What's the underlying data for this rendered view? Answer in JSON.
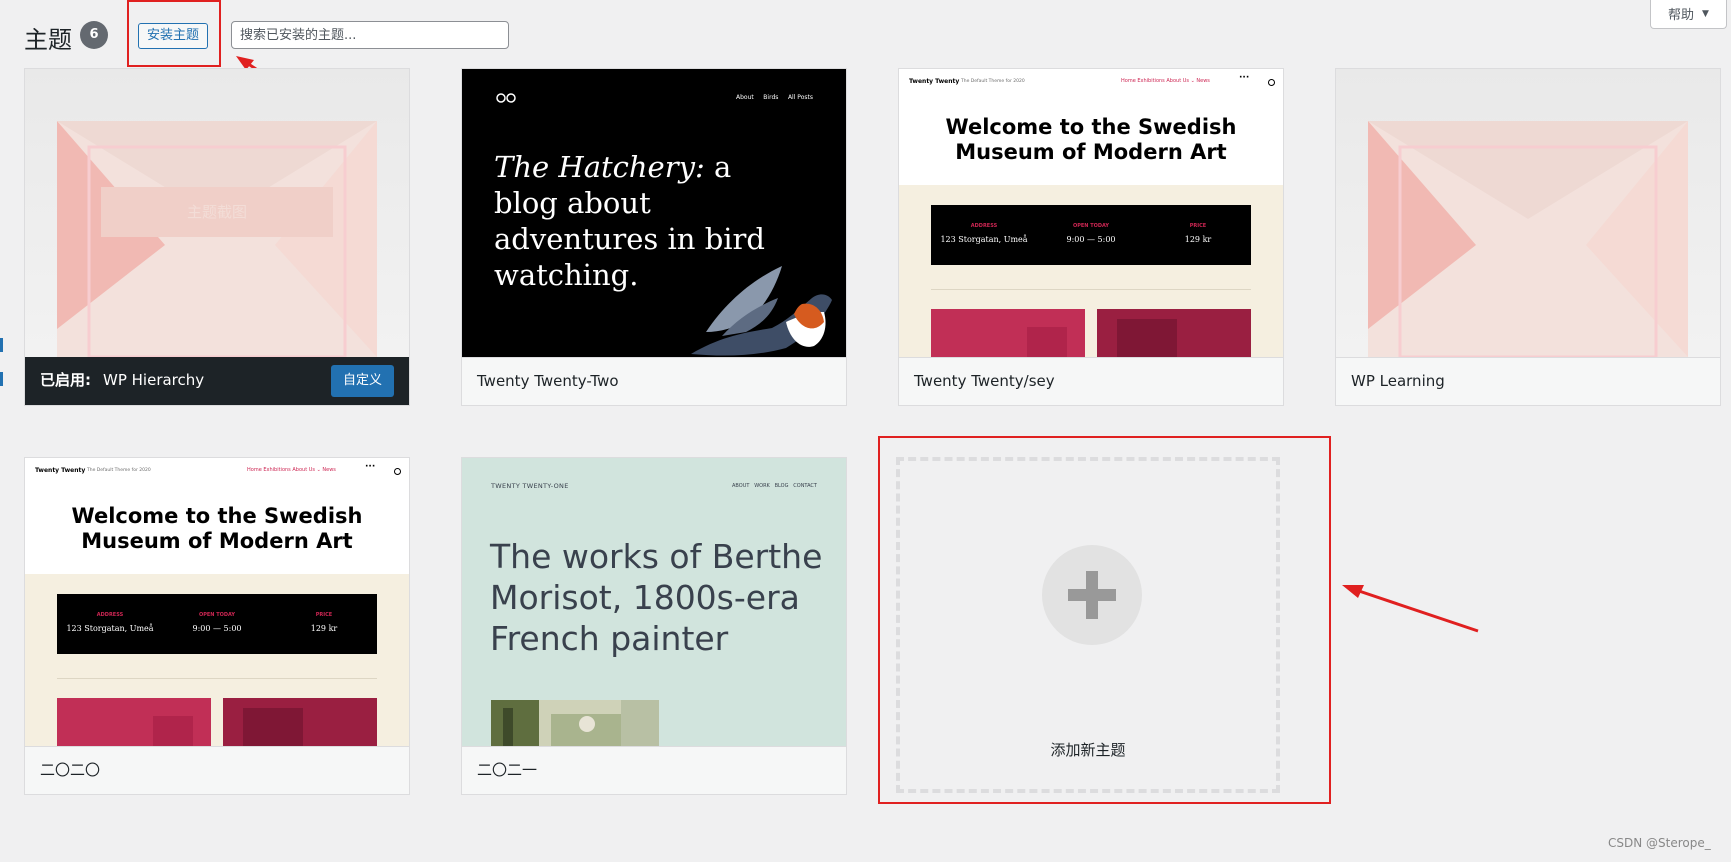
{
  "header": {
    "title": "主题",
    "count": "6",
    "install_label": "安装主题",
    "search_placeholder": "搜索已安装的主题...",
    "help_label": "帮助"
  },
  "themes": [
    {
      "name": "WP Hierarchy",
      "active": true,
      "active_label": "已启用:",
      "customize_label": "自定义",
      "placeholder_text": "主题截图"
    },
    {
      "name": "Twenty Twenty-Two",
      "preview": {
        "nav": [
          "About",
          "Birds",
          "All Posts"
        ],
        "headline_italic": "The Hatchery:",
        "headline_rest": " a blog about adventures in bird watching."
      }
    },
    {
      "name": "Twenty Twenty/sey",
      "preview": {
        "brand": "Twenty Twenty",
        "tagline": "The Default Theme for 2020",
        "nav": "Home   Exhibitions   About Us ⌄   News",
        "headline": "Welcome to the Swedish Museum of Modern Art",
        "info": [
          {
            "label": "ADDRESS",
            "value": "123 Storgatan, Umeå"
          },
          {
            "label": "OPEN TODAY",
            "value": "9:00 — 5:00"
          },
          {
            "label": "PRICE",
            "value": "129 kr"
          }
        ]
      }
    },
    {
      "name": "WP Learning"
    },
    {
      "name": "二〇二〇",
      "preview": {
        "brand": "Twenty Twenty",
        "tagline": "The Default Theme for 2020",
        "nav": "Home   Exhibitions   About Us ⌄   News",
        "headline": "Welcome to the Swedish Museum of Modern Art",
        "info": [
          {
            "label": "ADDRESS",
            "value": "123 Storgatan, Umeå"
          },
          {
            "label": "OPEN TODAY",
            "value": "9:00 — 5:00"
          },
          {
            "label": "PRICE",
            "value": "129 kr"
          }
        ]
      }
    },
    {
      "name": "二〇二一",
      "preview": {
        "site_title": "TWENTY TWENTY-ONE",
        "nav": [
          "ABOUT",
          "WORK",
          "BLOG",
          "CONTACT"
        ],
        "headline": "The works of Berthe Morisot, 1800s-era French painter"
      }
    }
  ],
  "add_new": {
    "label": "添加新主题"
  },
  "watermark": "CSDN @Sterope_",
  "colors": {
    "annotation_red": "#e02020",
    "wp_blue": "#2271b1",
    "active_bar": "#1d2327",
    "tt_accent": "#cd2653",
    "tto_bg": "#d1e4dd"
  }
}
